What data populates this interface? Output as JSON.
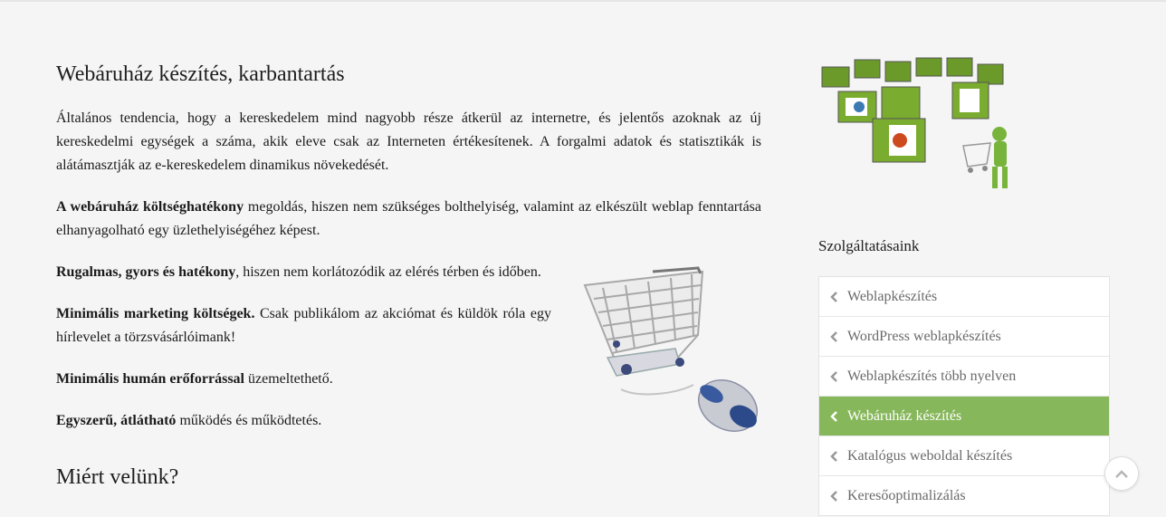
{
  "main": {
    "title": "Webáruház készítés, karbantartás",
    "p1": "Általános tendencia, hogy a kereskedelem mind nagyobb része átkerül az internetre, és jelentős azoknak az új kereskedelmi egységek a száma, akik eleve csak az Interneten értékesítenek. A forgalmi adatok és statisztikák is alátámasztják az e-kereskedelem dinamikus növekedését.",
    "p2_bold": "A webáruház költséghatékony",
    "p2_rest": " megoldás, hiszen nem szükséges bolthelyiség, valamint az elkészült weblap fenntartása elhanyagolható egy üzlethelyiségéhez képest.",
    "p3_bold": "Rugalmas, gyors és hatékony",
    "p3_rest": ", hiszen nem korlátozódik az elérés térben és időben.",
    "p4_bold": "Minimális marketing költségek.",
    "p4_rest": " Csak publikálom az akciómat és küldök róla egy hírlevelet a törzsvásárlóimank!",
    "p5_bold": "Minimális humán erőforrással",
    "p5_rest": " üzemeltethető.",
    "p6_bold": "Egyszerű, átlátható",
    "p6_rest": " működés és működtetés.",
    "h2": "Miért velünk?"
  },
  "sidebar": {
    "title": "Szolgáltatásaink",
    "items": [
      {
        "label": "Weblapkészítés"
      },
      {
        "label": "WordPress weblapkészítés"
      },
      {
        "label": "Weblapkészítés több nyelven"
      },
      {
        "label": "Webáruház készítés",
        "active": true
      },
      {
        "label": "Katalógus weboldal készítés"
      },
      {
        "label": "Keresőoptimalizálás"
      }
    ]
  },
  "colors": {
    "accent": "#86b75a",
    "background": "#f5f5f5"
  },
  "icons": {
    "menu_item": "chevron-left-icon",
    "back_to_top": "chevron-up-icon"
  }
}
